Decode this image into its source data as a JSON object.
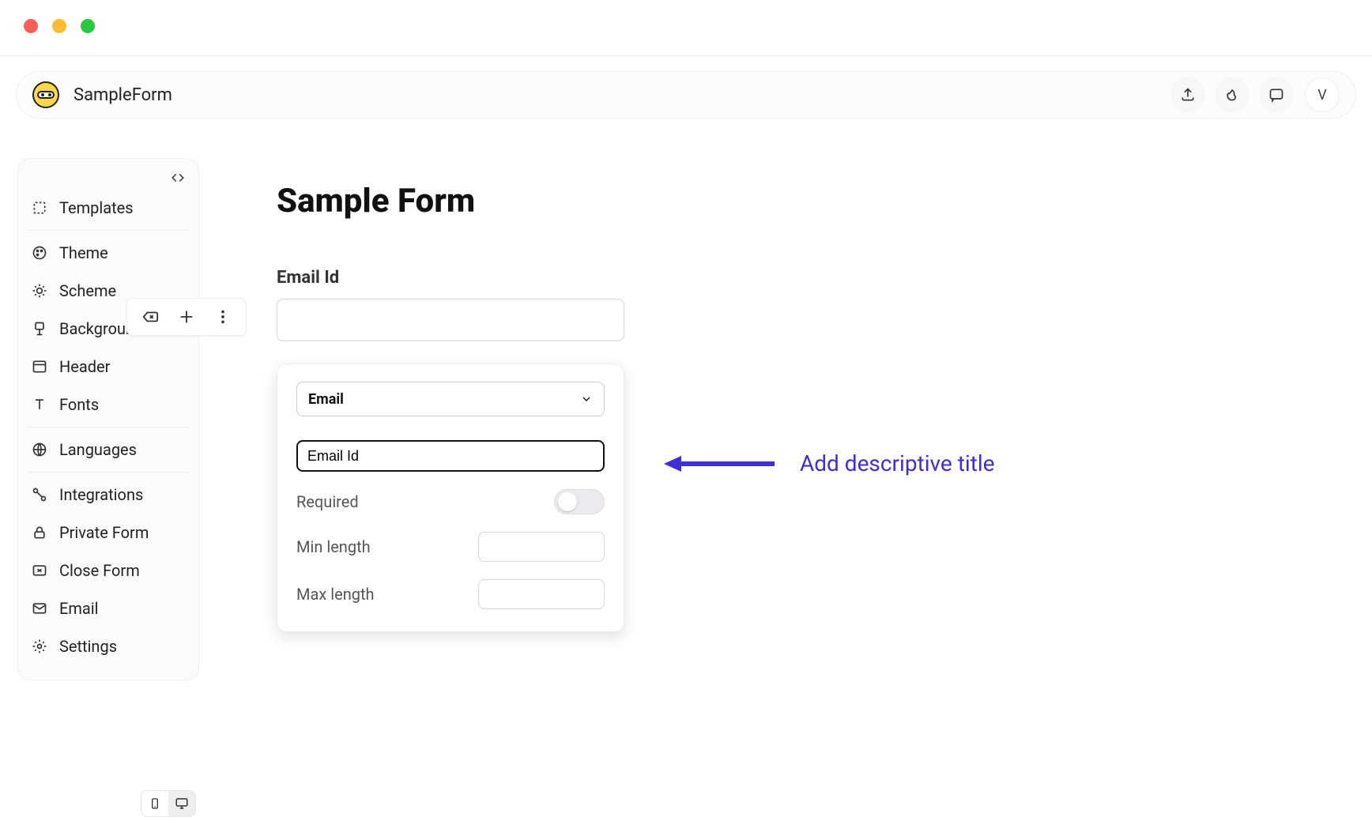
{
  "app": {
    "title": "SampleForm",
    "avatar_initial": "V"
  },
  "sidebar": {
    "items": [
      {
        "label": "Templates"
      },
      {
        "label": "Theme"
      },
      {
        "label": "Scheme"
      },
      {
        "label": "Background"
      },
      {
        "label": "Header"
      },
      {
        "label": "Fonts"
      },
      {
        "label": "Languages"
      },
      {
        "label": "Integrations"
      },
      {
        "label": "Private Form"
      },
      {
        "label": "Close Form"
      },
      {
        "label": "Email"
      },
      {
        "label": "Settings"
      }
    ]
  },
  "form": {
    "title": "Sample Form",
    "field_label": "Email Id",
    "field_value": ""
  },
  "popup": {
    "type_selected": "Email",
    "title_value": "Email Id",
    "required_label": "Required",
    "required": false,
    "min_label": "Min length",
    "min_value": "",
    "max_label": "Max length",
    "max_value": ""
  },
  "annotation": {
    "text": "Add descriptive title",
    "color": "#3f2dd9"
  }
}
